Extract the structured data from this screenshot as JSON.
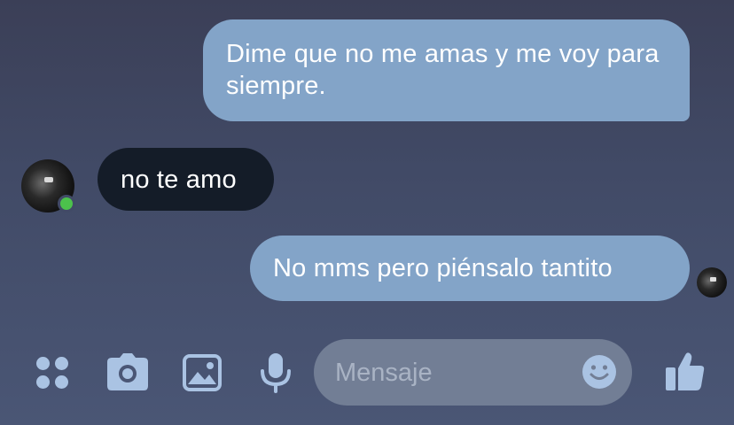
{
  "conversation": {
    "messages": [
      {
        "sender": "me",
        "text": "Dime que no me amas y me voy para siempre."
      },
      {
        "sender": "contact",
        "text": "no te amo"
      },
      {
        "sender": "me",
        "text": "No mms pero piénsalo tantito"
      }
    ]
  },
  "contact": {
    "avatar": "avatar",
    "online": true
  },
  "composer": {
    "placeholder": "Mensaje",
    "icons": [
      "more-icon",
      "camera-icon",
      "gallery-icon",
      "mic-icon",
      "emoji-icon",
      "like-icon"
    ]
  },
  "colors": {
    "outgoing_bubble": "#83a4c8",
    "incoming_bubble": "#141c28",
    "icon_accent": "#aac3e3",
    "online": "#4cc24c",
    "input_background": "#727e95"
  }
}
